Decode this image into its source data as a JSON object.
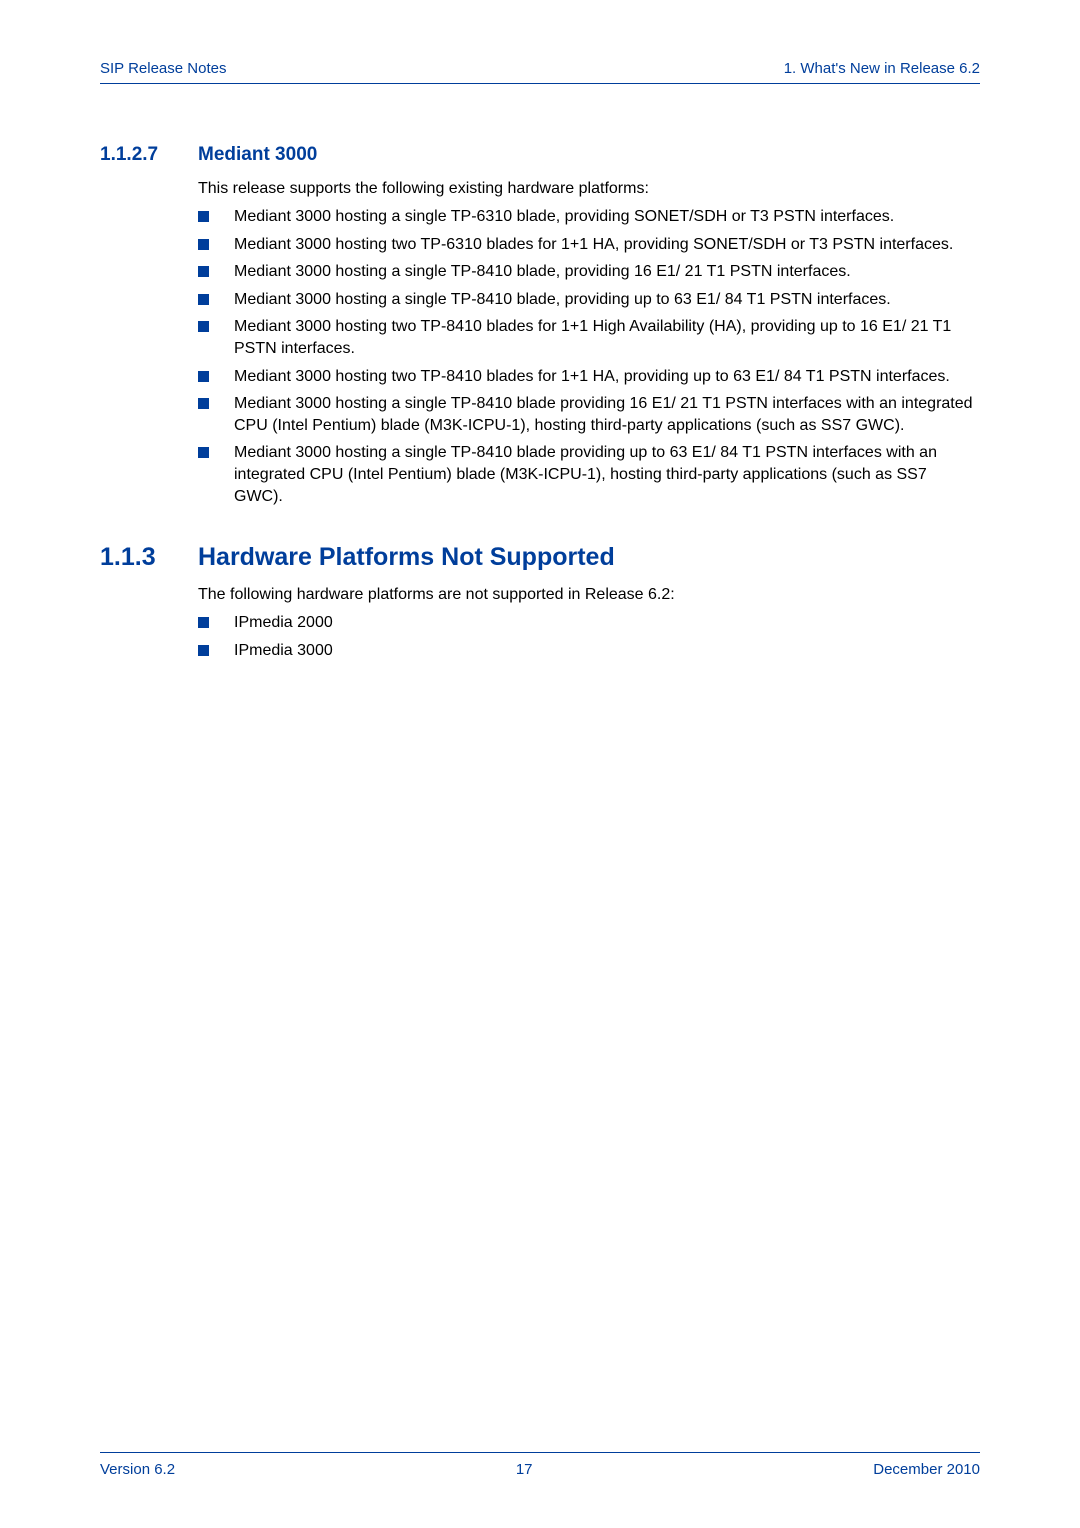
{
  "header": {
    "left": "SIP Release Notes",
    "right": "1. What's New in Release 6.2"
  },
  "section1": {
    "number": "1.1.2.7",
    "title": "Mediant 3000",
    "intro": "This release supports the following existing hardware platforms:",
    "bullets": [
      "Mediant 3000 hosting a single TP-6310 blade, providing SONET/SDH or T3 PSTN interfaces.",
      "Mediant 3000 hosting two TP-6310 blades for 1+1 HA, providing SONET/SDH or T3 PSTN interfaces.",
      "Mediant 3000 hosting a single TP-8410 blade, providing 16 E1/ 21 T1 PSTN interfaces.",
      "Mediant 3000 hosting a single TP-8410 blade, providing up to 63 E1/ 84 T1 PSTN interfaces.",
      "Mediant 3000 hosting two TP-8410 blades for 1+1 High Availability (HA), providing up to 16 E1/ 21 T1 PSTN interfaces.",
      "Mediant 3000 hosting two TP-8410 blades for 1+1 HA, providing up to  63 E1/ 84 T1 PSTN interfaces.",
      "Mediant 3000 hosting a single TP-8410 blade providing 16 E1/ 21 T1 PSTN interfaces with an integrated CPU (Intel Pentium) blade (M3K-ICPU-1), hosting third-party applications (such as SS7 GWC).",
      "Mediant 3000 hosting a single TP-8410 blade providing up to 63 E1/ 84 T1 PSTN interfaces with an integrated CPU (Intel Pentium) blade (M3K-ICPU-1), hosting third-party applications (such as SS7 GWC)."
    ]
  },
  "section2": {
    "number": "1.1.3",
    "title": "Hardware Platforms Not Supported",
    "intro": "The following hardware platforms are not supported in Release 6.2:",
    "bullets": [
      "IPmedia 2000",
      "IPmedia 3000"
    ]
  },
  "footer": {
    "left": "Version 6.2",
    "center": "17",
    "right": "December 2010"
  }
}
